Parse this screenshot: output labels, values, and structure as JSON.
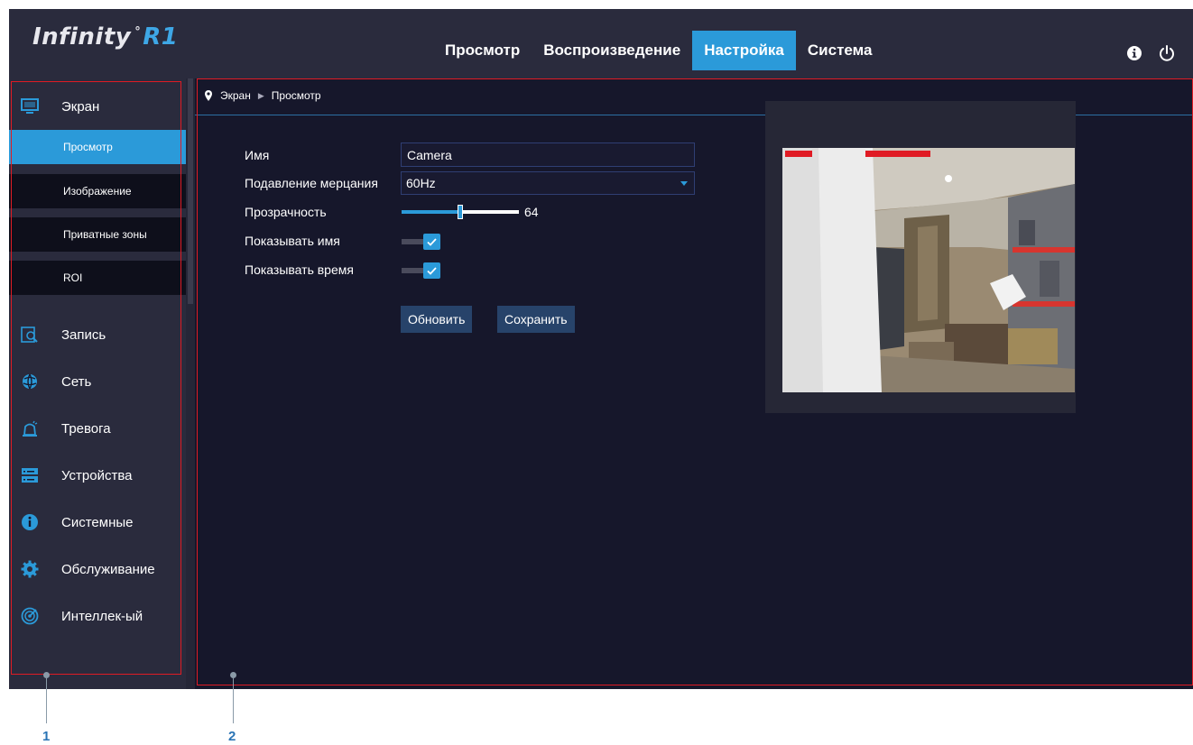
{
  "logo": {
    "brand": "Infinity",
    "dot": "°",
    "model": "R1"
  },
  "topmenu": [
    {
      "label": "Просмотр"
    },
    {
      "label": "Воспроизведение"
    },
    {
      "label": "Настройка",
      "active": true
    },
    {
      "label": "Система"
    }
  ],
  "top_icons": [
    "info-icon",
    "power-icon"
  ],
  "sidebar": {
    "items": [
      {
        "label": "Экран",
        "icon": "monitor-icon"
      },
      {
        "label": "Запись",
        "icon": "record-search-icon"
      },
      {
        "label": "Сеть",
        "icon": "network-globe-icon"
      },
      {
        "label": "Тревога",
        "icon": "alarm-siren-icon"
      },
      {
        "label": "Устройства",
        "icon": "storage-devices-icon"
      },
      {
        "label": "Системные",
        "icon": "info-circle-icon"
      },
      {
        "label": "Обслуживание",
        "icon": "gear-icon"
      },
      {
        "label": "Интеллек-ый",
        "icon": "smart-radar-icon"
      }
    ],
    "subitems": [
      {
        "label": "Просмотр",
        "active": true
      },
      {
        "label": "Изображение"
      },
      {
        "label": "Приватные зоны"
      },
      {
        "label": "ROI"
      }
    ]
  },
  "breadcrumb": {
    "root": "Экран",
    "current": "Просмотр"
  },
  "form": {
    "name_label": "Имя",
    "name_value": "Camera",
    "flicker_label": "Подавление мерцания",
    "flicker_value": "60Hz",
    "transparency_label": "Прозрачность",
    "transparency_value": "64",
    "transparency_fraction": 0.5,
    "show_name_label": "Показывать имя",
    "show_name_checked": true,
    "show_time_label": "Показывать время",
    "show_time_checked": true
  },
  "buttons": {
    "refresh": "Обновить",
    "save": "Сохранить"
  },
  "callouts": {
    "first": "1",
    "second": "2"
  },
  "colors": {
    "accent": "#2b9ad9",
    "annotation": "#e01b24",
    "callout_number": "#2a74b5"
  }
}
